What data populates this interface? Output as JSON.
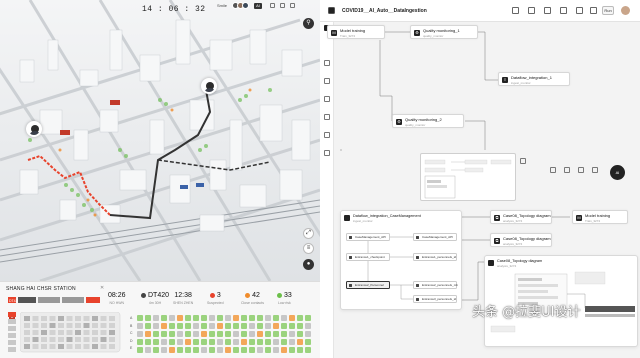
{
  "colors": {
    "route_red": "#e8432c",
    "route_dark": "#333333",
    "accent_dark": "#222222",
    "orange": "#f08c2c",
    "green": "#6cbf4a",
    "grey_badge": "#888888"
  },
  "map_header": {
    "clock": "14 : 06 : 32",
    "user": "Smile",
    "badge": "AI"
  },
  "station_panel": {
    "station_name": "SHANG HAI CHSR STATION",
    "stats": [
      {
        "value": "08:26",
        "label": "NO HWN"
      },
      {
        "value": "DT420",
        "label": "4m 30H"
      },
      {
        "value": "12:38",
        "label": "SHEN ZHEN"
      },
      {
        "value": "3",
        "label": "Suspected",
        "color": "#e8432c"
      },
      {
        "value": "42",
        "label": "Close contacts",
        "color": "#f08c2c"
      },
      {
        "value": "33",
        "label": "Low risk",
        "color": "#6cbf4a"
      }
    ],
    "train_label": "DT420",
    "car_numbers": [
      "1",
      "2",
      "3"
    ],
    "seat_rows": [
      "A",
      "B",
      "C",
      "D",
      "E"
    ]
  },
  "editor": {
    "title": "COVID19__AI_Auto__DataIngestion",
    "toolbar_button": "Run",
    "nodes": [
      {
        "title": "Model training",
        "subtitle": "Train_3274"
      },
      {
        "title": "Quality monitoring_1",
        "subtitle": "quality_monitor"
      },
      {
        "title": "Dataflow_integration_1",
        "subtitle": "ingest_monitor"
      },
      {
        "title": "Quality monitoring_2",
        "subtitle": "quality_monitor"
      }
    ],
    "integration_card": {
      "title": "Dataflow_integration_CaseManagement",
      "subtitle": "ingest_monitor"
    },
    "inner_nodes": [
      "CaseManagement_API",
      "CaseManagement_API",
      "Entrance1_checkpoint",
      "Entrance1_personnels_id",
      "Entrance2_Personnel",
      "Entrance2_personnels_mb",
      "Entrance3_personnels_id"
    ],
    "right_nodes": [
      {
        "title": "Case08_Topology diagram",
        "subtitle": "analysis_3274"
      },
      {
        "title": "Model training",
        "subtitle": "Train_3274"
      },
      {
        "title": "Case08_Topology diagram",
        "subtitle": "analysis_3274"
      },
      {
        "title": "Case08_Topology diagram",
        "subtitle": "analysis_3274"
      }
    ]
  },
  "watermark": "头条 @拉斐UI设计"
}
